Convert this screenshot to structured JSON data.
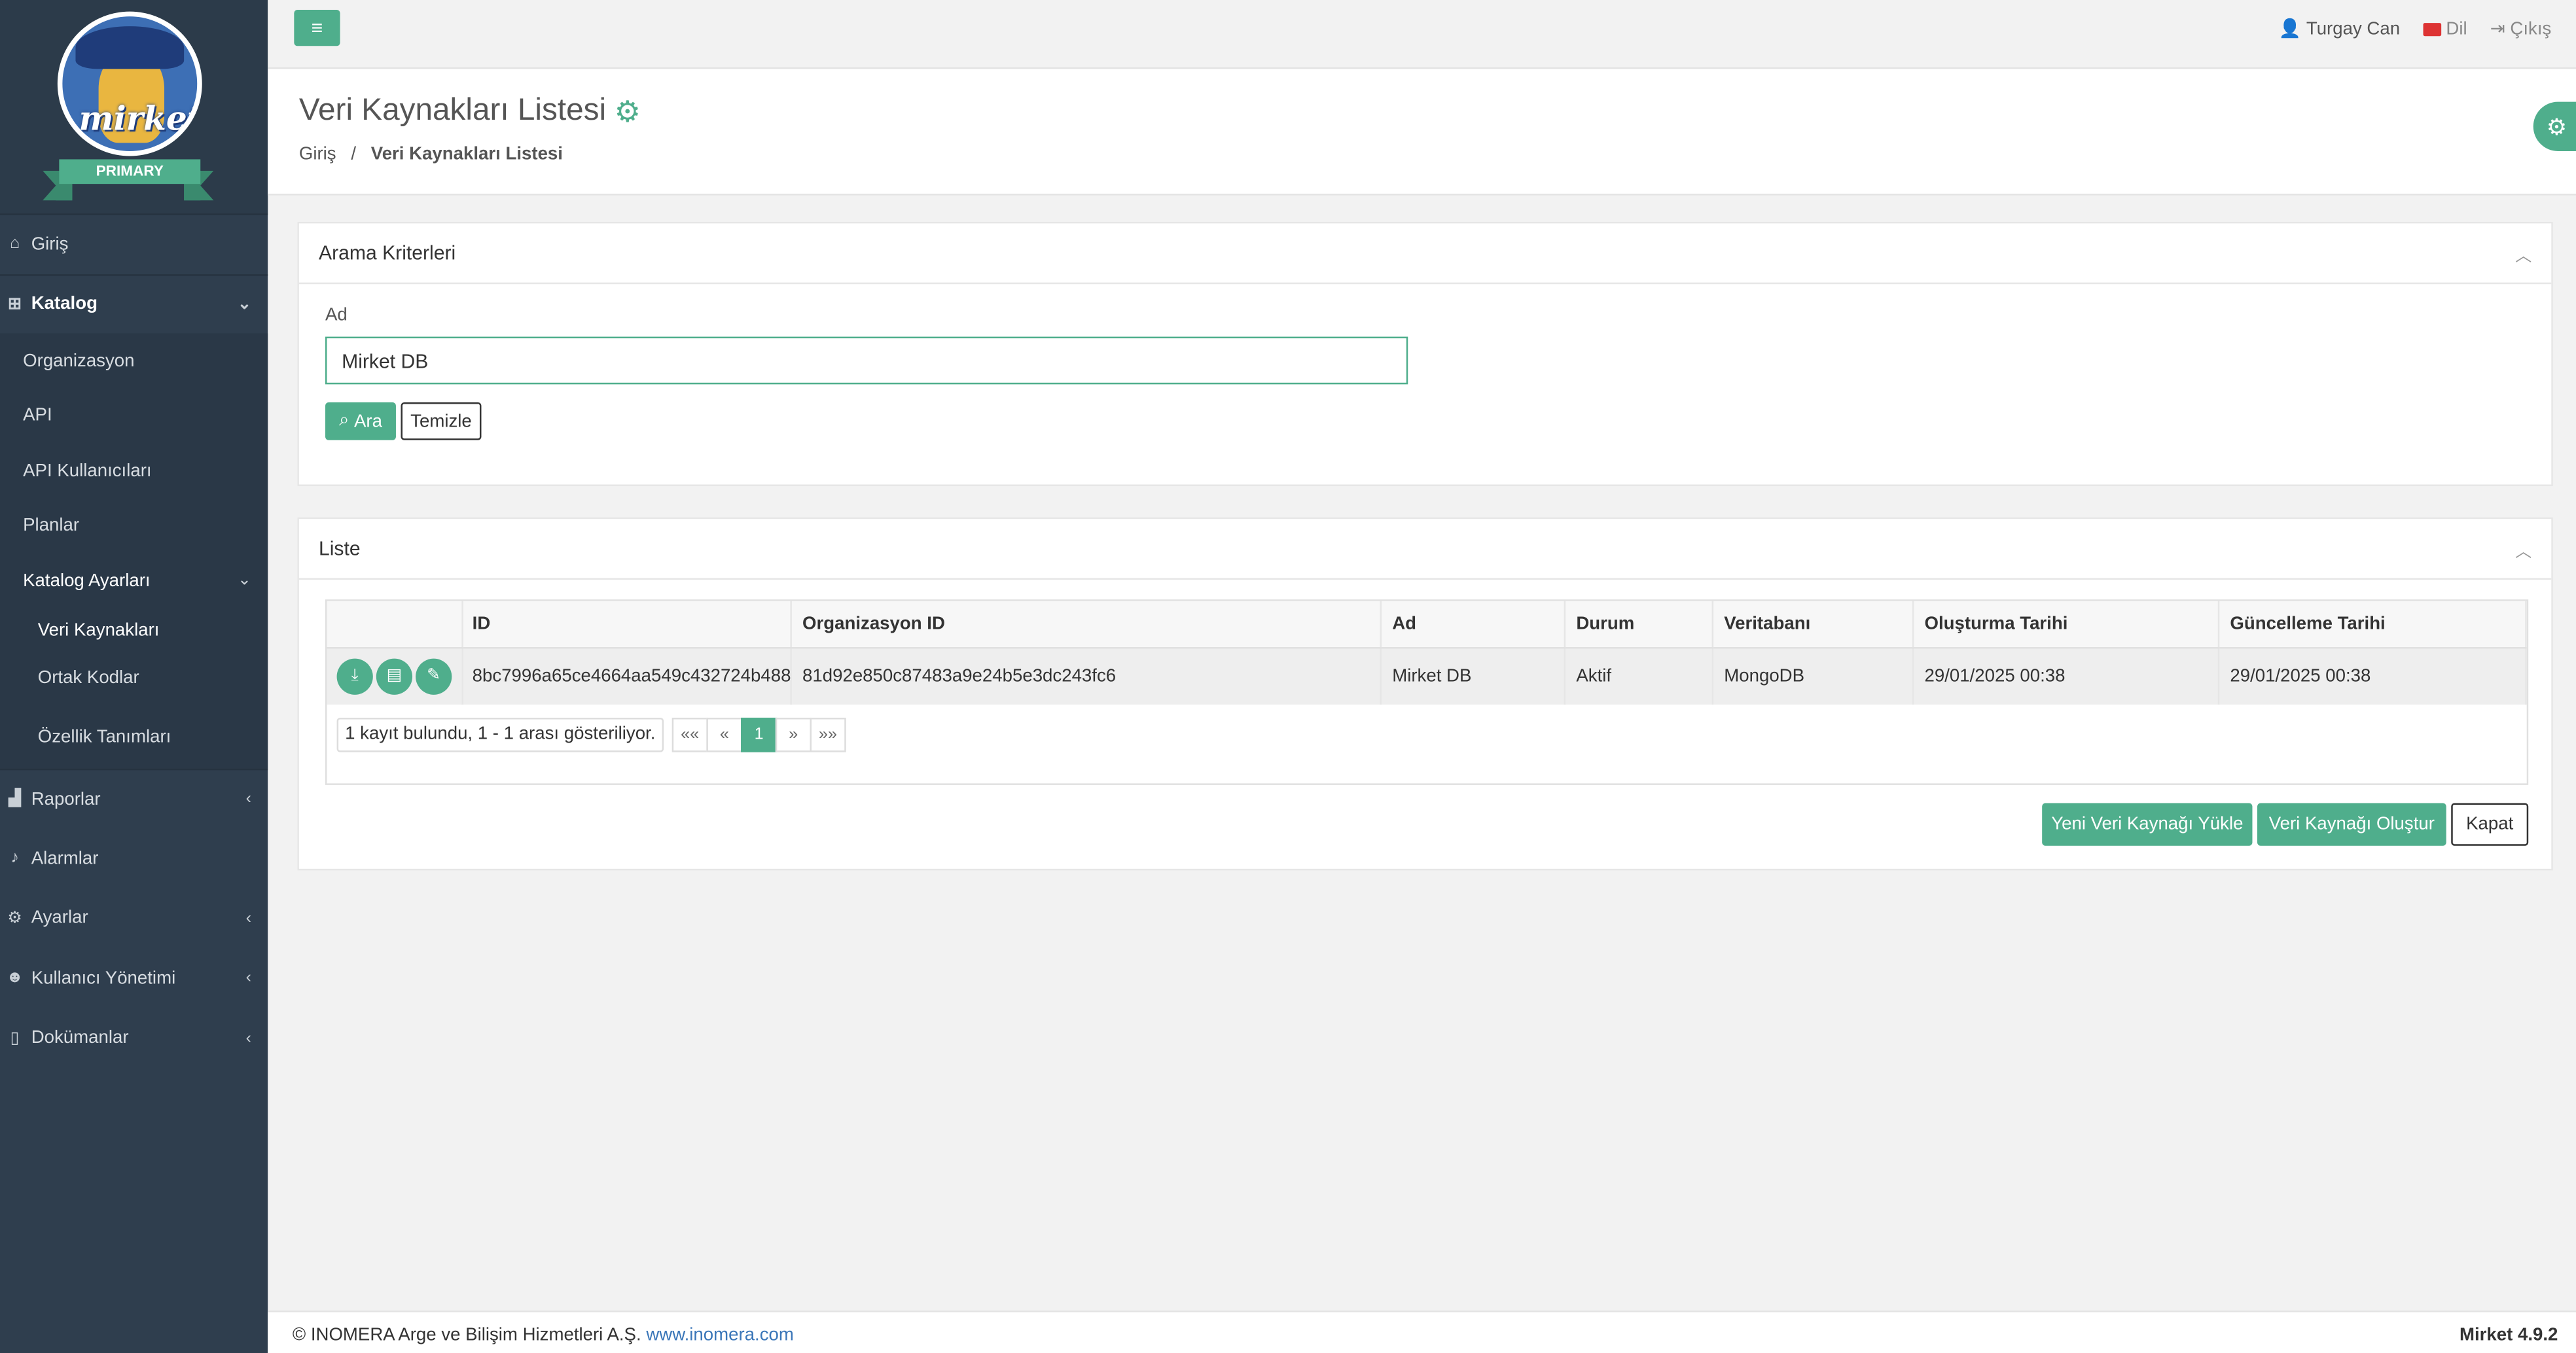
{
  "brand": {
    "logo_text": "mirket",
    "ribbon": "PRIMARY"
  },
  "sidebar": {
    "items": [
      {
        "label": "Giriş",
        "icon": "home-icon"
      },
      {
        "label": "Katalog",
        "icon": "sitemap-icon"
      },
      {
        "label": "Raporlar",
        "icon": "chart-icon"
      },
      {
        "label": "Alarmlar",
        "icon": "bell-icon"
      },
      {
        "label": "Ayarlar",
        "icon": "gears-icon"
      },
      {
        "label": "Kullanıcı Yönetimi",
        "icon": "users-icon"
      },
      {
        "label": "Dokümanlar",
        "icon": "file-icon"
      }
    ],
    "katalog_sub": [
      {
        "label": "Organizasyon"
      },
      {
        "label": "API"
      },
      {
        "label": "API Kullanıcıları"
      },
      {
        "label": "Planlar"
      },
      {
        "label": "Katalog Ayarları"
      }
    ],
    "katalog_ayarlari_sub": [
      {
        "label": "Veri Kaynakları"
      },
      {
        "label": "Ortak Kodlar"
      },
      {
        "label": "Özellik Tanımları"
      }
    ]
  },
  "topbar": {
    "user": "Turgay Can",
    "language": "Dil",
    "logout": "Çıkış"
  },
  "page": {
    "title": "Veri Kaynakları Listesi",
    "breadcrumb_home": "Giriş",
    "breadcrumb_sep": "/",
    "breadcrumb_current": "Veri Kaynakları Listesi"
  },
  "search": {
    "panel_title": "Arama Kriterleri",
    "name_label": "Ad",
    "name_value": "Mirket DB",
    "search_button": "Ara",
    "clear_button": "Temizle"
  },
  "list": {
    "panel_title": "Liste",
    "columns": [
      "ID",
      "Organizasyon ID",
      "Ad",
      "Durum",
      "Veritabanı",
      "Oluşturma Tarihi",
      "Güncelleme Tarihi"
    ],
    "rows": [
      {
        "id": "8bc7996a65ce4664aa549c432724b488",
        "org_id": "81d92e850c87483a9e24b5e3dc243fc6",
        "name": "Mirket DB",
        "status": "Aktif",
        "database": "MongoDB",
        "created": "29/01/2025 00:38",
        "updated": "29/01/2025 00:38"
      }
    ],
    "pager_info": "1 kayıt bulundu, 1 - 1 arası gösteriliyor.",
    "pages": [
      "««",
      "«",
      "1",
      "»",
      "»»"
    ],
    "buttons": {
      "upload": "Yeni Veri Kaynağı Yükle",
      "create": "Veri Kaynağı Oluştur",
      "close": "Kapat"
    }
  },
  "footer": {
    "copyright": "© INOMERA Arge ve Bilişim Hizmetleri A.Ş.",
    "link": "www.inomera.com",
    "version": "Mirket 4.9.2"
  },
  "colors": {
    "accent": "#4fae8c",
    "sidebar": "#2f3e4e",
    "link": "#3a76b8"
  }
}
